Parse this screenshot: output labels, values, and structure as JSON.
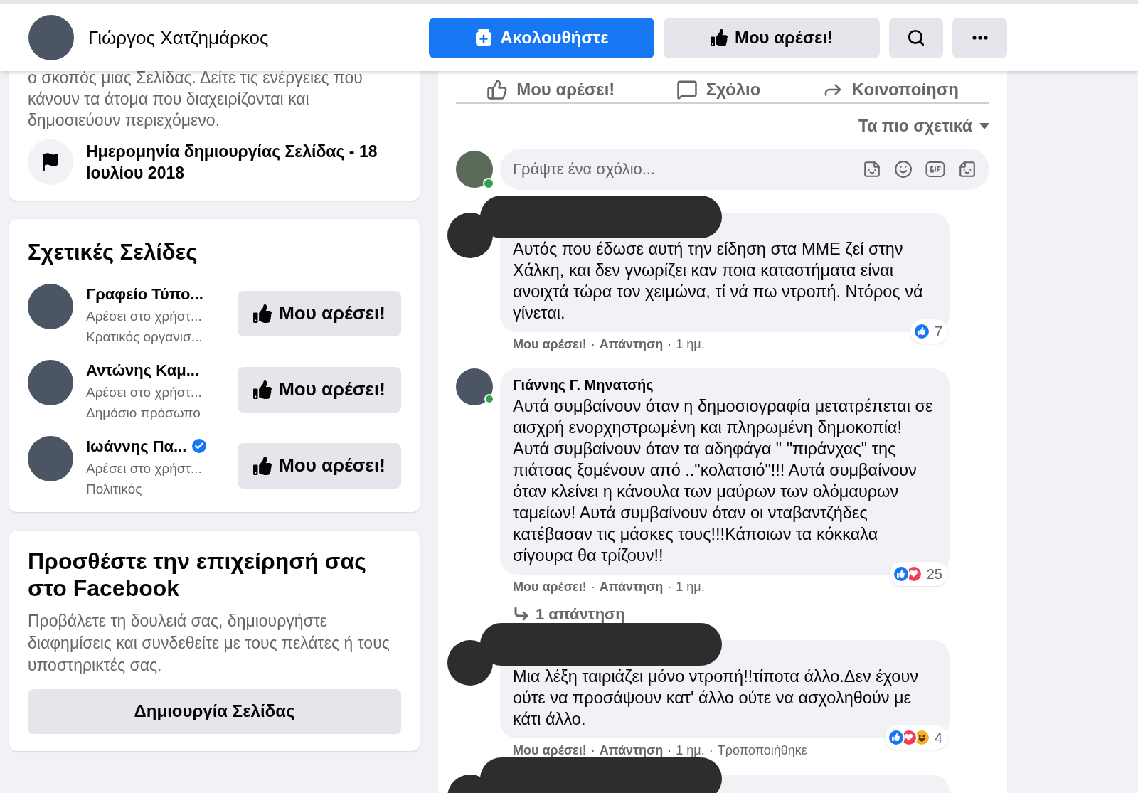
{
  "header": {
    "page_name": "Γιώργος Χατζημάρκος",
    "follow_button": "Ακολουθήστε",
    "like_button": "Μου αρέσει!"
  },
  "about_card": {
    "text": "ο σκοπός μιας Σελίδας. Δείτε τις ενέργειες που κάνουν τα άτομα που διαχειρίζονται και δημοσιεύουν περιεχόμενο.",
    "creation_date": "Ημερομηνία δημιουργίας Σελίδας - 18 Ιουλίου 2018"
  },
  "related_pages": {
    "title": "Σχετικές Σελίδες",
    "items": [
      {
        "name": "Γραφείο Τύπο...",
        "verified": false,
        "line_1": "Αρέσει στο χρήστ...",
        "line_2": "Κρατικός οργανισ...",
        "button": "Μου αρέσει!"
      },
      {
        "name": "Αντώνης Καμ...",
        "verified": false,
        "line_1": "Αρέσει στο χρήστ...",
        "line_2": "Δημόσιο πρόσωπο",
        "button": "Μου αρέσει!"
      },
      {
        "name": "Ιωάννης Πα...",
        "verified": true,
        "line_1": "Αρέσει στο χρήστ...",
        "line_2": "Πολιτικός",
        "button": "Μου αρέσει!"
      }
    ]
  },
  "business_card": {
    "title": "Προσθέστε την επιχείρησή σας στο Facebook",
    "text": "Προβάλετε τη δουλειά σας, δημιουργήστε διαφημίσεις και συνδεθείτε με τους πελάτες ή τους υποστηρικτές σας.",
    "button": "Δημιουργία Σελίδας"
  },
  "post_actions": [
    "Μου αρέσει!",
    "Σχόλιο",
    "Κοινοποίηση"
  ],
  "sort": "Τα πιο σχετικά",
  "comment_box": {
    "placeholder": "Γράψτε ένα σχόλιο...",
    "online": true
  },
  "meta_separator": "·",
  "comments": [
    {
      "redacted": true,
      "text": "Αυτός που έδωσε αυτή την είδηση στα ΜΜΕ ζεί στην Χάλκη, και δεν γνωρίζει καν ποια καταστήματα είναι ανοιχτά τώρα τον χειμώνα, τί νά πω ντροπή. Ντόρος νά γίνεται.",
      "reactions": [
        {
          "kind": "like"
        }
      ],
      "count": "7",
      "like": "Μου αρέσει!",
      "reply": "Απάντηση",
      "time": "1 ημ."
    },
    {
      "redacted": false,
      "author": "Γιάννης Γ. Μηνατσής",
      "online": true,
      "text": "Αυτά συμβαίνουν όταν η δημοσιογραφία μετατρέπεται σε αισχρή ενορχηστρωμένη και πληρωμένη δημοκοπία! Αυτά συμβαίνουν όταν τα αδηφάγα \" \"πιράνχας\" της πιάτσας ξομένουν από ..\"κολατσιό\"!!! Αυτά συμβαίνουν όταν κλείνει η κάνουλα των μαύρων των ολόμαυρων ταμείων! Αυτά συμβαίνουν όταν οι νταβαντζήδες κατέβασαν τις μάσκες τους!!!Κάποιων τα κόκκαλα σίγουρα θα τρίζουν!!",
      "reactions": [
        {
          "kind": "like"
        },
        {
          "kind": "love"
        }
      ],
      "count": "25",
      "like": "Μου αρέσει!",
      "reply": "Απάντηση",
      "time": "1 ημ.",
      "replies": "1 απάντηση"
    },
    {
      "redacted": true,
      "text": "Μια λέξη ταιριάζει μόνο ντροπή!!τίποτα άλλο.Δεν έχουν ούτε να προσάψουν κατ' άλλο ούτε να ασχοληθούν με κάτι άλλο.",
      "reactions": [
        {
          "kind": "like"
        },
        {
          "kind": "love"
        },
        {
          "kind": "haha"
        }
      ],
      "count": "4",
      "like": "Μου αρέσει!",
      "reply": "Απάντηση",
      "time": "1 ημ.",
      "edited": "Τροποποιήθηκε"
    },
    {
      "redacted": true
    }
  ]
}
